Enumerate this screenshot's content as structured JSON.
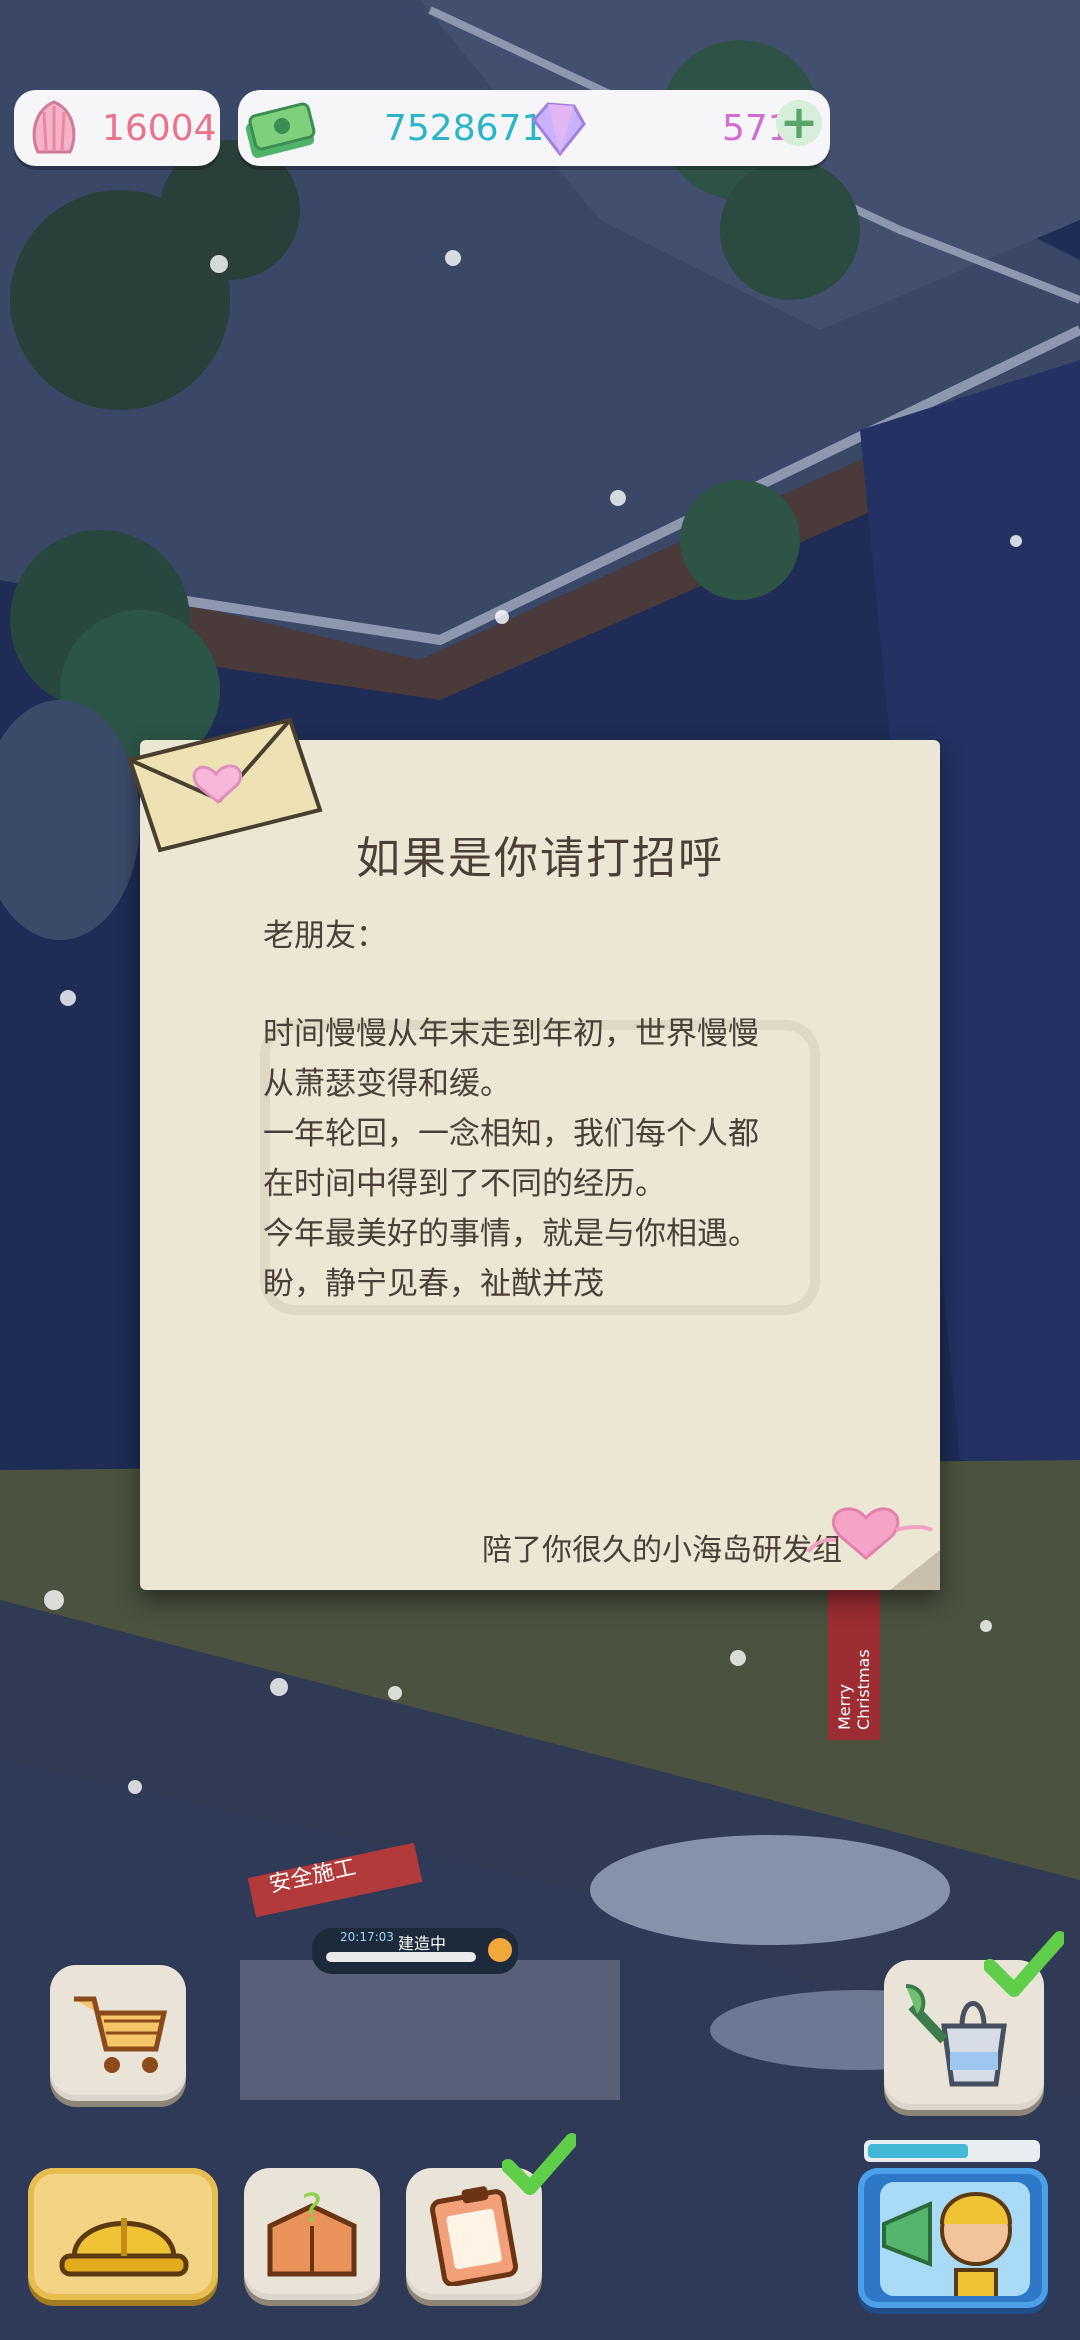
{
  "hud": {
    "shells": "16004",
    "cash": "7528671",
    "gems": "571",
    "add_label": "+"
  },
  "letter": {
    "title": "如果是你请打招呼",
    "greeting": "老朋友：",
    "lines": [
      "时间慢慢从年末走到年初，世界慢慢",
      "从萧瑟变得和缓。",
      "一年轮回，一念相知，我们每个人都",
      "在时间中得到了不同的经历。",
      "今年最美好的事情，就是与你相遇。",
      "盼，静宁见春，祉猷并茂"
    ],
    "signature": "陪了你很久的小海岛研发组"
  },
  "scene": {
    "construction_sign": "安全施工",
    "progress_label": "建造中",
    "progress_time": "20:17:03",
    "banner_text": "Merry Christmas"
  },
  "colors": {
    "shells_text": "#e8738a",
    "cash_text": "#2bb5c8",
    "gems_text": "#d26bd2",
    "check_green": "#5fcf4a"
  },
  "icons": {
    "shells": "shell-icon",
    "cash": "cash-icon",
    "gems": "gem-icon",
    "shop": "shopping-cart-icon",
    "build": "hard-hat-icon",
    "mystery": "mystery-box-icon",
    "tasks": "clipboard-icon",
    "water": "watering-bucket-icon",
    "character": "character-megaphone-icon"
  }
}
